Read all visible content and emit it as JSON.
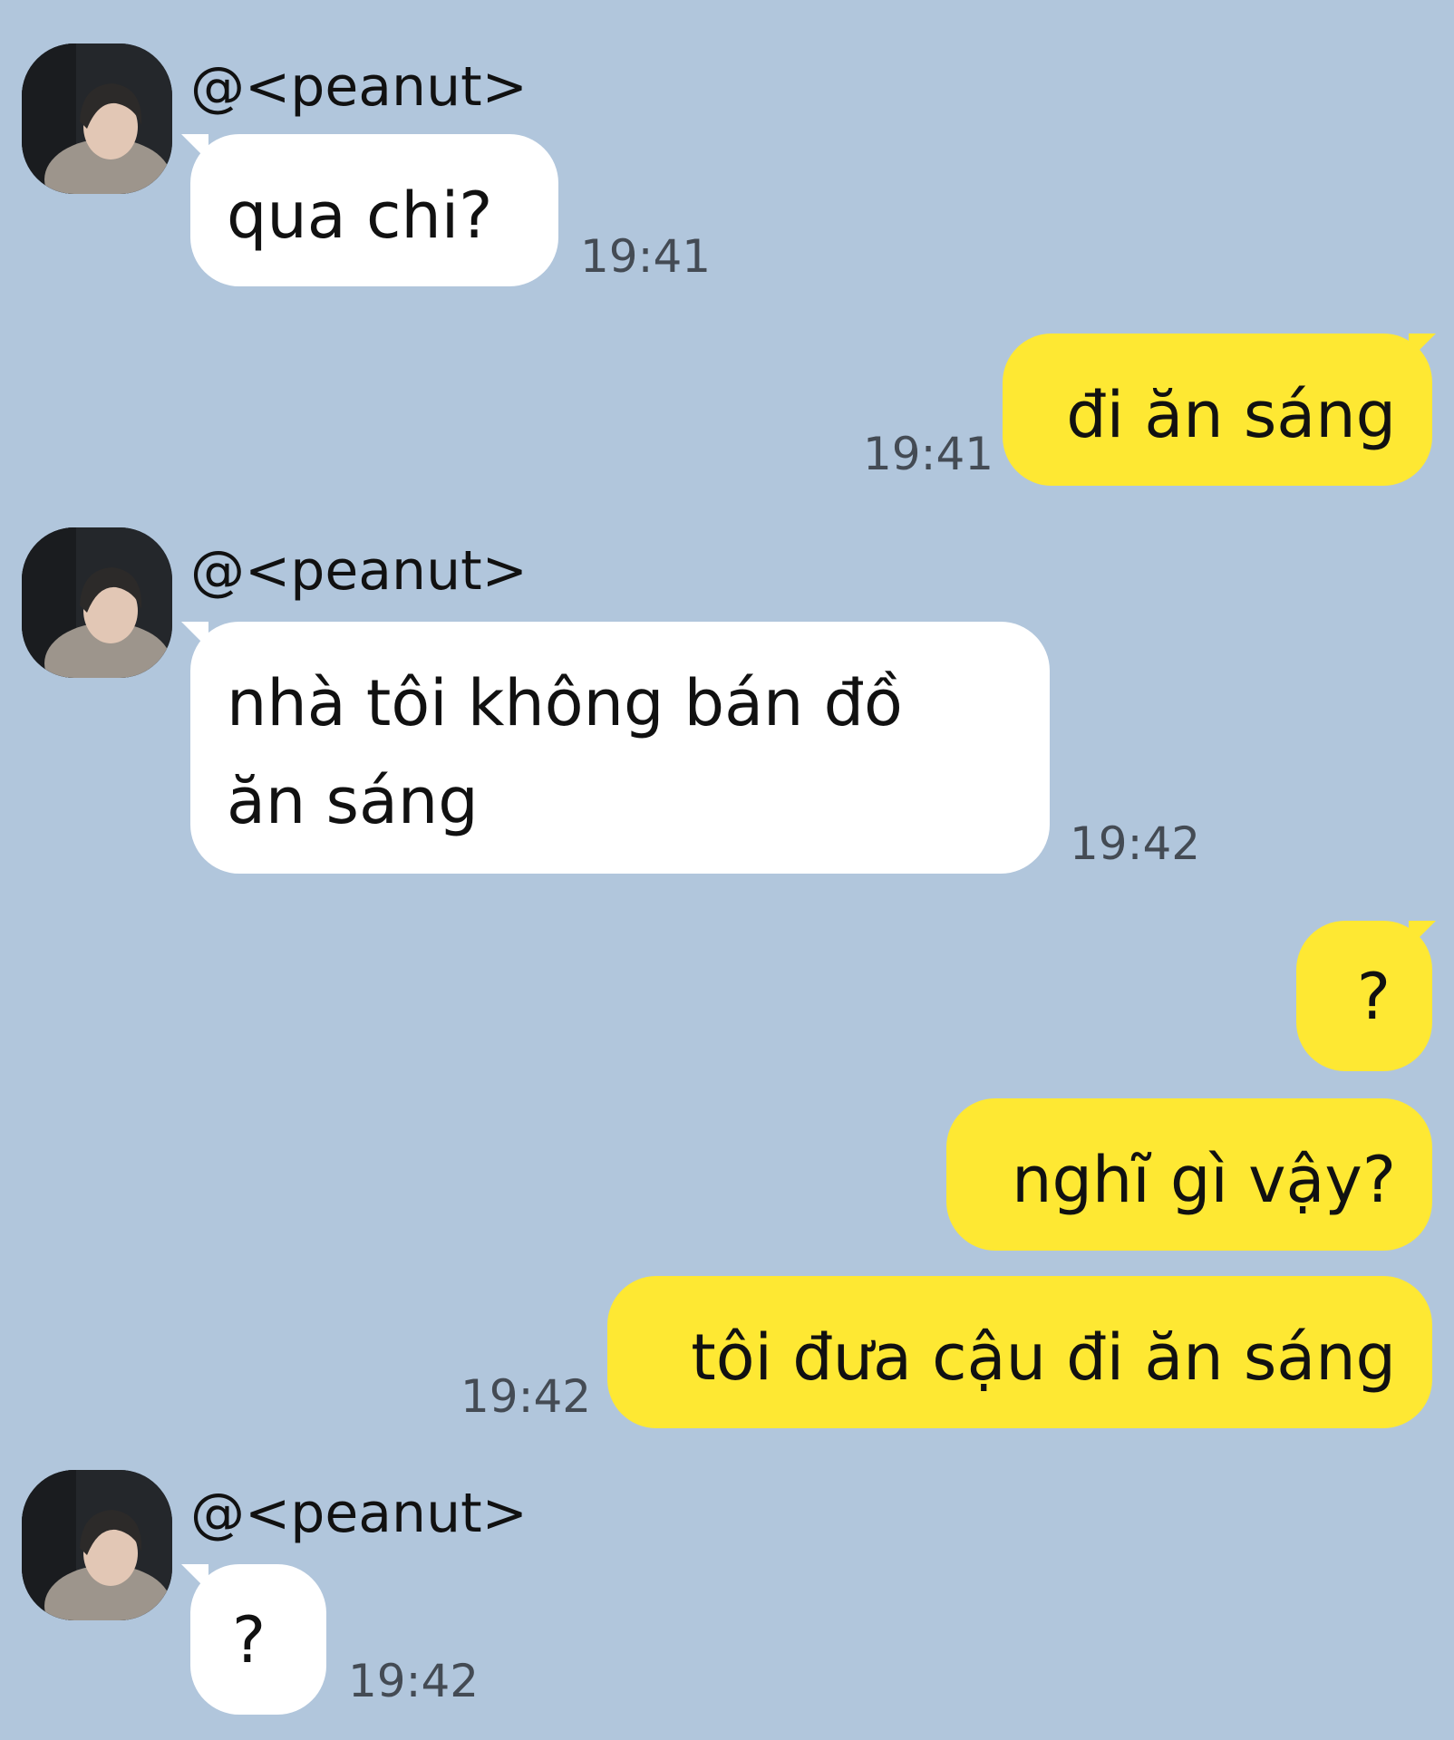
{
  "colors": {
    "background": "#b1c6dc",
    "incoming_bubble": "#ffffff",
    "outgoing_bubble": "#fee833",
    "timestamp": "#444b54"
  },
  "messages": [
    {
      "direction": "in",
      "sender": "@<peanut>",
      "text": "qua chi?",
      "time": "19:41"
    },
    {
      "direction": "out",
      "text": "đi ăn sáng",
      "time": "19:41"
    },
    {
      "direction": "in",
      "sender": "@<peanut>",
      "text": "nhà tôi không bán đồ\năn sáng",
      "time": "19:42"
    },
    {
      "direction": "out",
      "text": "?"
    },
    {
      "direction": "out",
      "text": "nghĩ gì vậy?"
    },
    {
      "direction": "out",
      "text": "tôi đưa cậu đi ăn sáng",
      "time": "19:42"
    },
    {
      "direction": "in",
      "sender": "@<peanut>",
      "text": "?",
      "time": "19:42"
    }
  ]
}
